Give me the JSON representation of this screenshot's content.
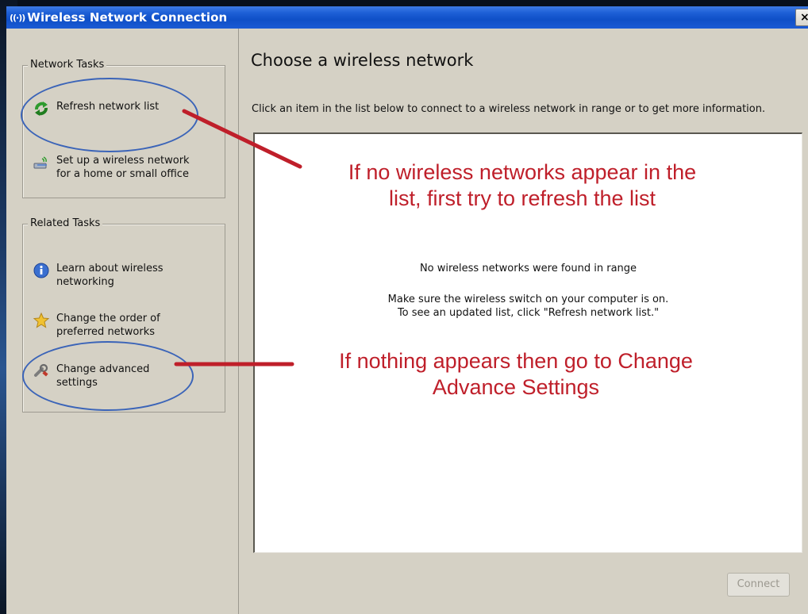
{
  "window": {
    "title": "Wireless Network Connection",
    "title_icon": "wireless-icon",
    "close_label": "×"
  },
  "sidebar": {
    "network_tasks": {
      "legend": "Network Tasks",
      "items": [
        {
          "label": "Refresh network list",
          "icon": "refresh-icon"
        },
        {
          "label": "Set up a wireless network\nfor a home or small office",
          "icon": "network-setup-icon"
        }
      ]
    },
    "related_tasks": {
      "legend": "Related Tasks",
      "items": [
        {
          "label": "Learn about wireless\nnetworking",
          "icon": "info-icon"
        },
        {
          "label": "Change the order of\npreferred networks",
          "icon": "star-icon"
        },
        {
          "label": "Change advanced\nsettings",
          "icon": "settings-icon"
        }
      ]
    }
  },
  "main": {
    "heading": "Choose a wireless network",
    "description": "Click an item in the list below to connect to a wireless network in range or to get more information.",
    "empty_message": "No wireless networks were found in range",
    "empty_hint": "Make sure the wireless switch on your computer is on.\nTo see an updated list, click \"Refresh network list.\"",
    "connect_label": "Connect"
  },
  "annotations": {
    "refresh_note": "If no wireless networks appear in the\nlist, first try to refresh the list",
    "advanced_note": "If nothing appears then go to Change\nAdvance Settings",
    "color": "#bf1f2a"
  },
  "colors": {
    "titlebar": "#1d5fd6",
    "dialog_bg": "#d5d1c5",
    "ellipse": "#3b64b8"
  }
}
